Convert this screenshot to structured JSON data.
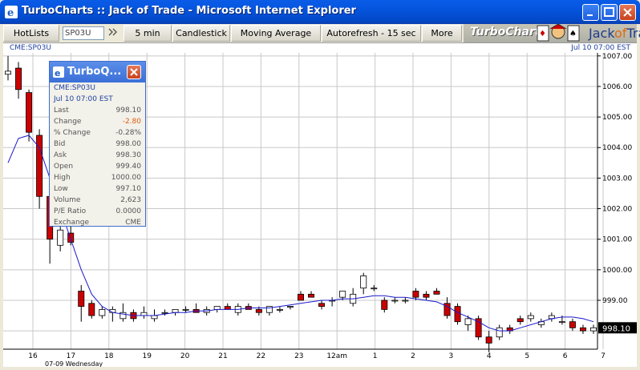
{
  "window": {
    "title": "TurboCharts :: Jack of Trade - Microsoft Internet Explorer"
  },
  "toolbar": {
    "hotlists": "HotLists",
    "symbol_value": "SP03U",
    "interval": "5 min",
    "chart_style": "Candlestick",
    "indicator": "Moving Average",
    "autorefresh": "Autorefresh - 15 sec",
    "more": "More",
    "brand": "TurboCharts",
    "logo_text_1": "Jack",
    "logo_text_2": "of",
    "logo_text_3": "Trad"
  },
  "strip": {
    "symbol": "CME:SP03U",
    "datetime": "Jul 10 07:00 EST"
  },
  "popup": {
    "title": "TurboQ...",
    "symbol": "CME:SP03U",
    "datetime": "Jul 10 07:00 EST",
    "rows": [
      {
        "label": "Last",
        "value": "998.10"
      },
      {
        "label": "Change",
        "value": "-2.80"
      },
      {
        "label": "% Change",
        "value": "-0.28%"
      },
      {
        "label": "Bid",
        "value": "998.00"
      },
      {
        "label": "Ask",
        "value": "998.30"
      },
      {
        "label": "Open",
        "value": "999.40"
      },
      {
        "label": "High",
        "value": "1000.00"
      },
      {
        "label": "Low",
        "value": "997.10"
      },
      {
        "label": "Volume",
        "value": "2,623"
      },
      {
        "label": "P/E Ratio",
        "value": "0.0000"
      },
      {
        "label": "Exchange",
        "value": "CME"
      }
    ]
  },
  "chart_data": {
    "type": "candlestick",
    "y_ticks": [
      "1007.00",
      "1006.00",
      "1005.00",
      "1004.00",
      "1003.00",
      "1002.00",
      "1001.00",
      "1000.00",
      "999.00"
    ],
    "ylim": [
      997.4,
      1007.1
    ],
    "last_price_label": "998.10",
    "x_ticks": [
      "16",
      "17",
      "18",
      "19",
      "20",
      "21",
      "22",
      "23",
      "12am",
      "1",
      "2",
      "3",
      "4",
      "5",
      "6",
      "7"
    ],
    "x_sublabel": "07-09 Wednesday",
    "grid": true,
    "colors": {
      "down": "#cc0000",
      "up": "#ffffff",
      "ma": "#1a1acc"
    },
    "candles": [
      [
        1006.4,
        1007.0,
        1006.2,
        1006.5
      ],
      [
        1006.6,
        1006.8,
        1005.6,
        1005.9
      ],
      [
        1005.8,
        1005.9,
        1004.2,
        1004.5
      ],
      [
        1004.4,
        1004.6,
        1002.0,
        1002.4
      ],
      [
        1002.4,
        1002.8,
        1000.2,
        1001.0
      ],
      [
        1000.8,
        1001.5,
        1000.6,
        1001.3
      ],
      [
        1001.2,
        1001.6,
        1000.8,
        1000.9
      ],
      [
        999.3,
        999.5,
        998.3,
        998.8
      ],
      [
        998.9,
        999.0,
        998.4,
        998.5
      ],
      [
        998.5,
        998.8,
        998.4,
        998.7
      ],
      [
        998.6,
        998.8,
        998.3,
        998.7
      ],
      [
        998.4,
        998.9,
        998.3,
        998.6
      ],
      [
        998.6,
        998.7,
        998.3,
        998.4
      ],
      [
        998.5,
        998.8,
        998.4,
        998.6
      ],
      [
        998.4,
        998.7,
        998.3,
        998.5
      ],
      [
        998.6,
        998.7,
        998.5,
        998.6
      ],
      [
        998.6,
        998.7,
        998.5,
        998.7
      ],
      [
        998.7,
        998.8,
        998.6,
        998.7
      ],
      [
        998.7,
        998.9,
        998.6,
        998.6
      ],
      [
        998.6,
        998.8,
        998.5,
        998.7
      ],
      [
        998.7,
        998.8,
        998.6,
        998.8
      ],
      [
        998.8,
        998.9,
        998.7,
        998.7
      ],
      [
        998.6,
        998.9,
        998.5,
        998.8
      ],
      [
        998.8,
        998.9,
        998.7,
        998.7
      ],
      [
        998.7,
        998.8,
        998.5,
        998.6
      ],
      [
        998.6,
        998.8,
        998.5,
        998.8
      ],
      [
        998.7,
        998.8,
        998.6,
        998.7
      ],
      [
        998.8,
        998.8,
        998.7,
        998.8
      ],
      [
        999.2,
        999.3,
        999.0,
        999.0
      ],
      [
        999.2,
        999.3,
        999.1,
        999.1
      ],
      [
        998.9,
        999.0,
        998.7,
        998.8
      ],
      [
        999.0,
        999.1,
        998.8,
        999.0
      ],
      [
        999.1,
        999.3,
        999.0,
        999.3
      ],
      [
        998.9,
        999.4,
        998.8,
        999.2
      ],
      [
        999.4,
        999.9,
        999.2,
        999.8
      ],
      [
        999.4,
        999.5,
        999.3,
        999.4
      ],
      [
        999.0,
        999.1,
        998.6,
        998.7
      ],
      [
        999.0,
        999.1,
        998.9,
        999.0
      ],
      [
        999.0,
        999.1,
        998.9,
        999.0
      ],
      [
        999.3,
        999.4,
        999.0,
        999.1
      ],
      [
        999.2,
        999.3,
        999.0,
        999.1
      ],
      [
        999.3,
        999.4,
        999.2,
        999.2
      ],
      [
        998.9,
        999.1,
        998.4,
        998.5
      ],
      [
        998.8,
        998.9,
        998.2,
        998.3
      ],
      [
        998.2,
        998.5,
        998.0,
        998.4
      ],
      [
        998.4,
        998.5,
        997.7,
        997.8
      ],
      [
        997.8,
        998.0,
        997.3,
        997.6
      ],
      [
        997.8,
        998.2,
        997.7,
        998.1
      ],
      [
        998.1,
        998.2,
        997.9,
        998.0
      ],
      [
        998.4,
        998.5,
        998.2,
        998.3
      ],
      [
        998.4,
        998.6,
        998.3,
        998.5
      ],
      [
        998.2,
        998.4,
        998.1,
        998.3
      ],
      [
        998.4,
        998.6,
        998.3,
        998.5
      ],
      [
        998.3,
        998.5,
        998.2,
        998.3
      ],
      [
        998.3,
        998.4,
        998.0,
        998.1
      ],
      [
        998.1,
        998.2,
        997.9,
        998.0
      ],
      [
        998.0,
        998.2,
        997.9,
        998.1
      ]
    ],
    "moving_average": [
      1003.5,
      1004.3,
      1004.4,
      1004.0,
      1003.0,
      1002.0,
      1001.0,
      1000.0,
      999.2,
      998.8,
      998.6,
      998.55,
      998.5,
      998.5,
      998.5,
      998.55,
      998.6,
      998.6,
      998.65,
      998.65,
      998.7,
      998.7,
      998.7,
      998.75,
      998.75,
      998.75,
      998.8,
      998.85,
      998.9,
      998.95,
      999.0,
      999.0,
      999.05,
      999.05,
      999.1,
      999.15,
      999.15,
      999.1,
      999.1,
      999.05,
      999.0,
      998.95,
      998.8,
      998.6,
      998.45,
      998.3,
      998.1,
      998.0,
      998.0,
      998.1,
      998.2,
      998.3,
      998.4,
      998.45,
      998.45,
      998.4,
      998.3
    ]
  }
}
